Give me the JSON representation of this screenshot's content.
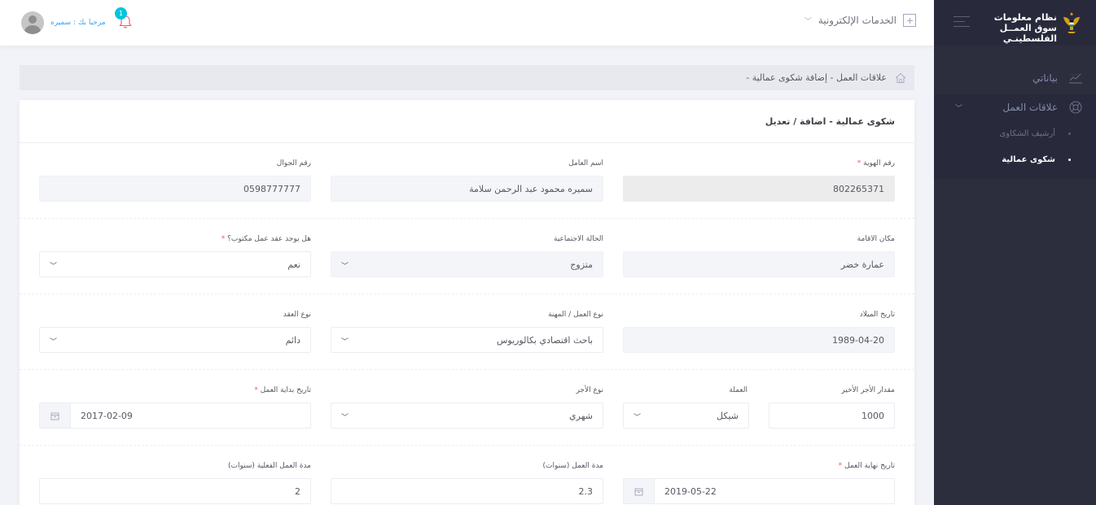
{
  "sidebar": {
    "brand_title": "نظام معلومات سوق العمــل الفلسطينـي",
    "items": [
      {
        "label": "بياناتي"
      },
      {
        "label": "علاقات العمل"
      }
    ],
    "sub_items": [
      {
        "label": "أرشيف الشكاوى"
      },
      {
        "label": "شكوى عمالية"
      }
    ]
  },
  "header": {
    "eservices_label": "الخدمات الإلكترونية",
    "greeting": "مرحبا بك : سميره",
    "notification_count": "1"
  },
  "breadcrumb": {
    "text": "- علاقات العمل - إضافة شكوى عمالية"
  },
  "form": {
    "title": "شكوى عمالية - اضافة / تعديل",
    "id_label": "رقم الهوية",
    "id_value": "802265371",
    "worker_name_label": "اسم العامل",
    "worker_name_value": "سميره محمود عبد الرحمن سلامة",
    "mobile_label": "رقم الجوال",
    "mobile_value": "0598777777",
    "residence_label": "مكان الاقامة",
    "residence_value": "عمارة خضر",
    "marital_label": "الحالة الاجتماعية",
    "marital_value": "متزوج",
    "contract_written_label": "هل يوجد عقد عمل مكتوب؟",
    "contract_written_value": "نعم",
    "birth_label": "تاريخ الميلاد",
    "birth_value": "1989-04-20",
    "job_label": "نوع العمل / المهنة",
    "job_value": "باحث اقتصادي بكالوريوس",
    "contract_type_label": "نوع العقد",
    "contract_type_value": "دائم",
    "wage_label": "مقدار الأجر الأخير",
    "wage_value": "1000",
    "currency_label": "العملة",
    "currency_value": "شيكل",
    "wage_type_label": "نوع الأجر",
    "wage_type_value": "شهري",
    "start_label": "تاريخ بداية العمل",
    "start_value": "2017-02-09",
    "end_label": "تاريخ نهاية العمل",
    "end_value": "2019-05-22",
    "duration_label": "مدة العمل (سنوات)",
    "duration_value": "2.3",
    "actual_duration_label": "مدة العمل الفعلية (سنوات)",
    "actual_duration_value": "2"
  },
  "colors": {
    "sidebar_bg": "#2c2e3e",
    "accent": "#36a3f7",
    "required": "#f4516c",
    "badge": "#00c5dc"
  }
}
